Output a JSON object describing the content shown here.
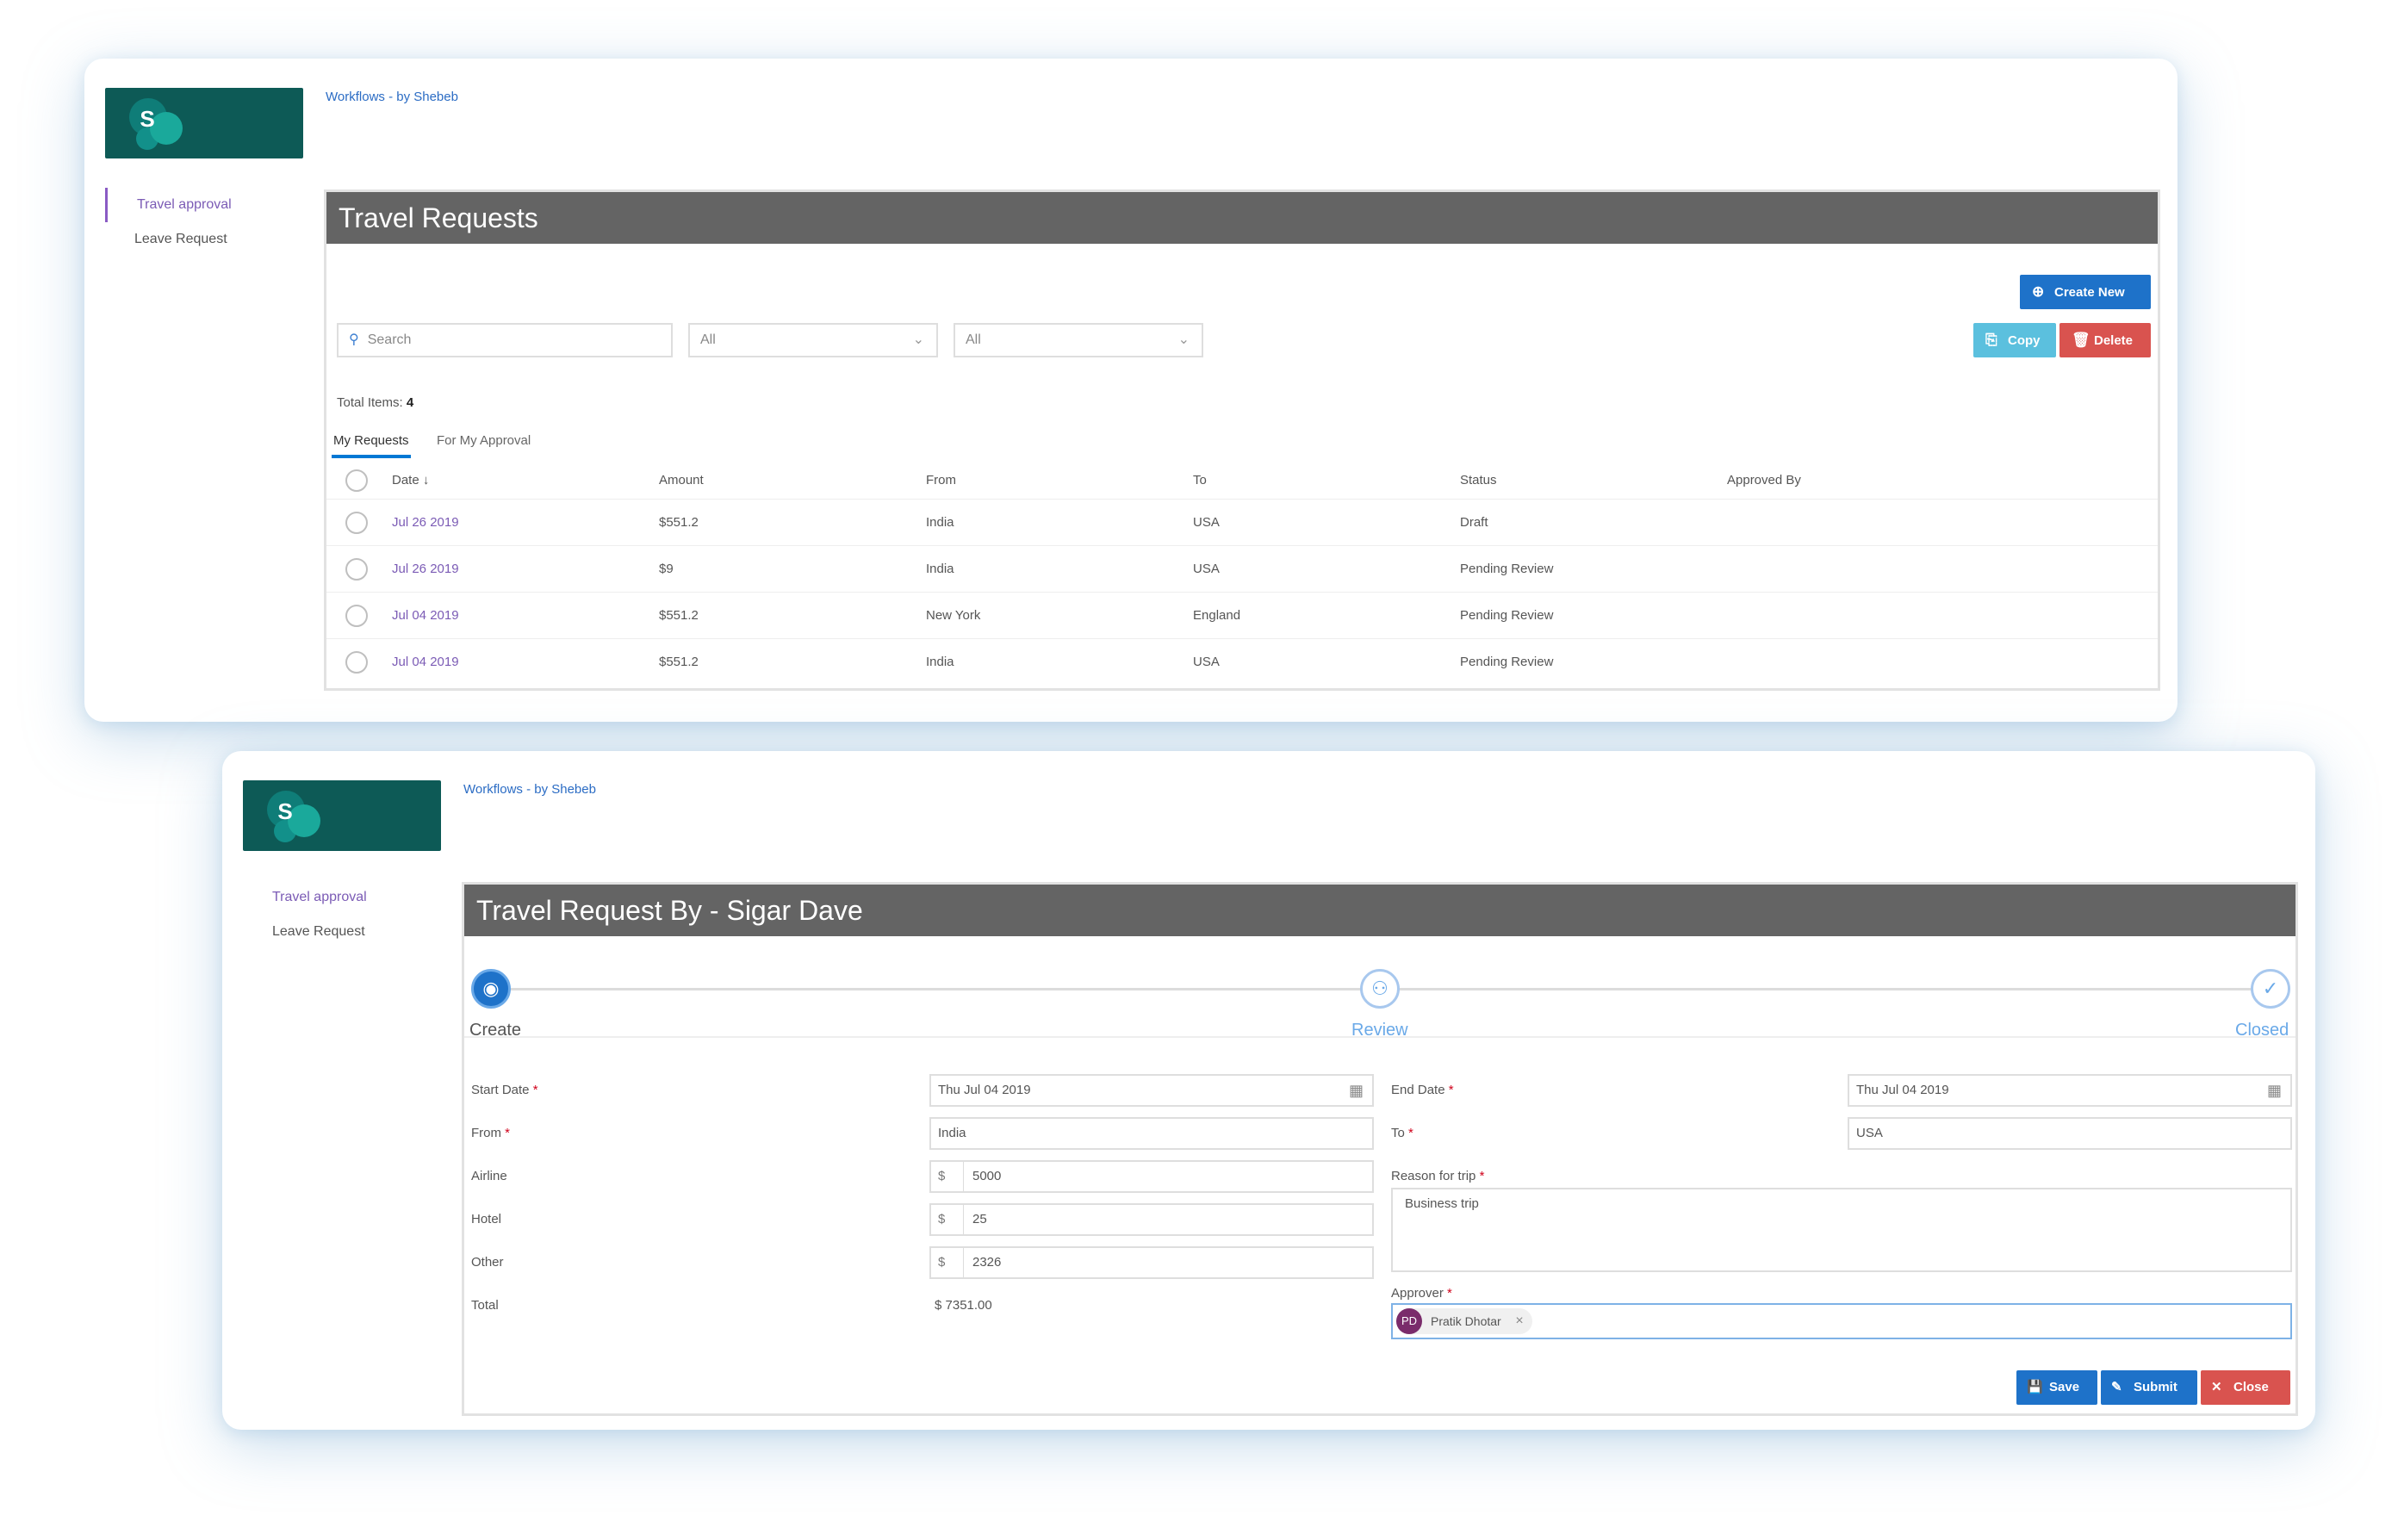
{
  "colors": {
    "logo_bg": "#0d5a56",
    "header_bg": "#646464",
    "primary": "#1e72c9",
    "copy": "#5bc0de",
    "danger": "#d9534f",
    "link": "#7b5bb5"
  },
  "list_view": {
    "breadcrumb": "Workflows - by Shebeb",
    "nav": [
      "Travel approval",
      "Leave Request"
    ],
    "header_title": "Travel Requests",
    "create_new_label": "Create New",
    "search_placeholder": "Search",
    "filter1_value": "All",
    "filter2_value": "All",
    "copy_label": "Copy",
    "delete_label": "Delete",
    "total_items_label": "Total Items:",
    "total_items_value": "4",
    "tabs": [
      "My Requests",
      "For My Approval"
    ],
    "columns": [
      "Date",
      "Amount",
      "From",
      "To",
      "Status",
      "Approved By"
    ],
    "sort_indicator": "↓",
    "rows": [
      {
        "date": "Jul 26 2019",
        "amount": "$551.2",
        "from": "India",
        "to": "USA",
        "status": "Draft",
        "approved_by": ""
      },
      {
        "date": "Jul 26 2019",
        "amount": "$9",
        "from": "India",
        "to": "USA",
        "status": "Pending Review",
        "approved_by": ""
      },
      {
        "date": "Jul 04 2019",
        "amount": "$551.2",
        "from": "New York",
        "to": "England",
        "status": "Pending Review",
        "approved_by": ""
      },
      {
        "date": "Jul 04 2019",
        "amount": "$551.2",
        "from": "India",
        "to": "USA",
        "status": "Pending Review",
        "approved_by": ""
      }
    ]
  },
  "form_view": {
    "breadcrumb": "Workflows - by Shebeb",
    "nav": [
      "Travel approval",
      "Leave Request"
    ],
    "header_title": "Travel Request By - Sigar Dave",
    "steps": [
      {
        "label": "Create",
        "state": "done"
      },
      {
        "label": "Review",
        "state": "pending"
      },
      {
        "label": "Closed",
        "state": "pending"
      }
    ],
    "labels": {
      "start_date": "Start Date",
      "end_date": "End Date",
      "from": "From",
      "to": "To",
      "airline": "Airline",
      "hotel": "Hotel",
      "other": "Other",
      "total": "Total",
      "reason": "Reason for trip",
      "approver": "Approver"
    },
    "required_mark": "*",
    "currency_symbol": "$",
    "values": {
      "start_date": "Thu Jul 04 2019",
      "end_date": "Thu Jul 04 2019",
      "from": "India",
      "to": "USA",
      "airline": "5000",
      "hotel": "25",
      "other": "2326",
      "total": "$ 7351.00",
      "reason": "Business trip"
    },
    "approver": {
      "initials": "PD",
      "name": "Pratik Dhotar"
    },
    "buttons": {
      "save": "Save",
      "submit": "Submit",
      "close": "Close"
    }
  }
}
